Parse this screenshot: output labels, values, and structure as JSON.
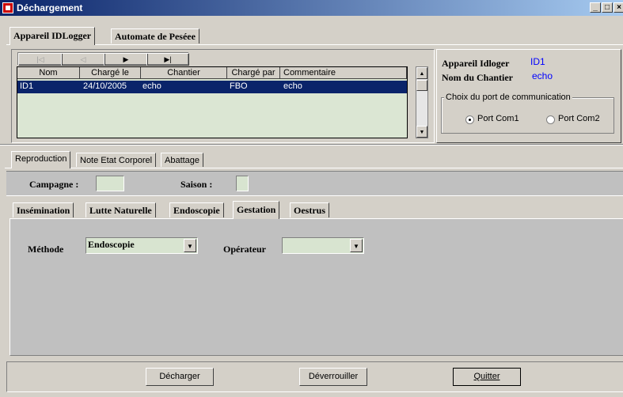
{
  "window": {
    "title": "Déchargement"
  },
  "top_tabs": [
    "Appareil IDLogger",
    "Automate de Peséee"
  ],
  "navigator": {
    "first": "|◁",
    "prev": "◁",
    "next": "▶",
    "last": "▶|"
  },
  "grid": {
    "columns": [
      "Nom",
      "Chargé le",
      "Chantier",
      "Chargé par",
      "Commentaire"
    ],
    "rows": [
      [
        "ID1",
        "24/10/2005",
        "echo",
        "FBO",
        "echo"
      ]
    ]
  },
  "info": {
    "appareil_label": "Appareil Idloger",
    "appareil_value": "ID1",
    "chantier_label": "Nom du Chantier",
    "chantier_value": "echo",
    "port_group_label": "Choix du port de communication",
    "port_options": [
      "Port Com1",
      "Port Com2"
    ],
    "port_selected": "Port Com1"
  },
  "middle_tabs": [
    "Reproduction",
    "Note Etat Corporel",
    "Abattage"
  ],
  "campagne": {
    "label": "Campagne :",
    "value": ""
  },
  "saison": {
    "label": "Saison :",
    "value": ""
  },
  "sub_tabs": [
    "Insémination",
    "Lutte Naturelle",
    "Endoscopie",
    "Gestation",
    "Oestrus"
  ],
  "gestation": {
    "methode_label": "Méthode",
    "methode_value": "Endoscopie",
    "operateur_label": "Opérateur",
    "operateur_value": ""
  },
  "buttons": {
    "decharger": "Décharger",
    "deverrouiller": "Déverrouiller",
    "quitter": "Quitter"
  },
  "colors": {
    "titlebar": "#0a246a",
    "grid_bg": "#d8e4d0",
    "selection": "#0a246a",
    "info_value": "#0000ff"
  }
}
